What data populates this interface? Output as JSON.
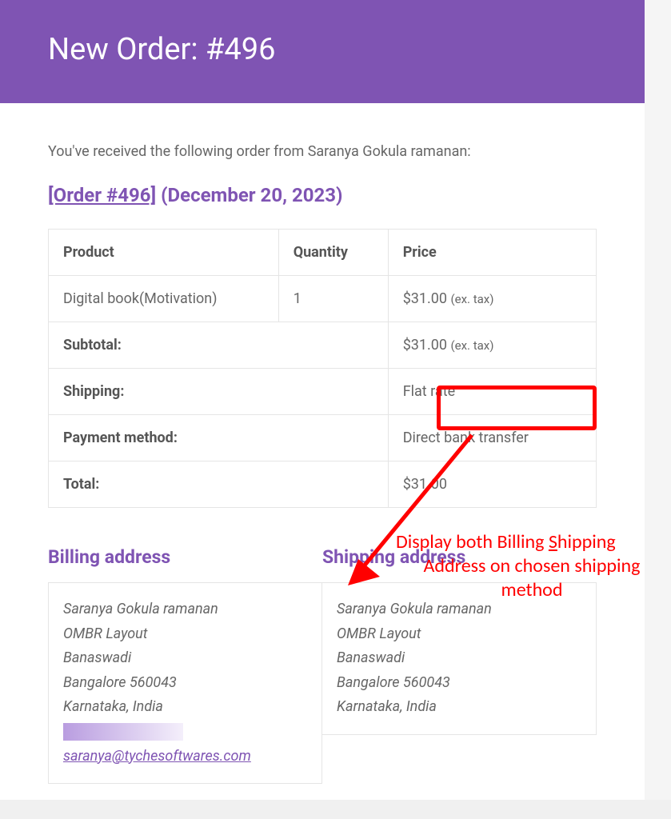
{
  "header": {
    "title": "New Order: #496"
  },
  "intro_text": "You've received the following order from Saranya Gokula ramanan:",
  "order_heading": {
    "order_link": "[Order #496]",
    "date_text": "(December 20, 2023)"
  },
  "table": {
    "headers": {
      "product": "Product",
      "quantity": "Quantity",
      "price": "Price"
    },
    "item": {
      "product": "Digital book(Motivation)",
      "quantity": "1",
      "price_amount": "$31.00",
      "price_suffix": "(ex. tax)"
    },
    "subtotal": {
      "label": "Subtotal:",
      "amount": "$31.00",
      "suffix": "(ex. tax)"
    },
    "shipping": {
      "label": "Shipping:",
      "value": "Flat rate"
    },
    "payment": {
      "label": "Payment method:",
      "value": "Direct bank transfer"
    },
    "total": {
      "label": "Total:",
      "value": "$31.00"
    }
  },
  "billing": {
    "heading": "Billing address",
    "name": "Saranya Gokula ramanan",
    "line1": "OMBR Layout",
    "line2": "Banaswadi",
    "line3": "Bangalore 560043",
    "line4": "Karnataka, India",
    "email": "saranya@tychesoftwares.com"
  },
  "shipping_addr": {
    "heading": "Shipping address",
    "name": "Saranya Gokula ramanan",
    "line1": "OMBR Layout",
    "line2": "Banaswadi",
    "line3": "Bangalore 560043",
    "line4": "Karnataka, India"
  },
  "annotation": {
    "line1a": "Display both Billing ",
    "line1b_underlined": "S",
    "line1c": "hipping",
    "line2": "Address on chosen shipping",
    "line3": "method"
  }
}
